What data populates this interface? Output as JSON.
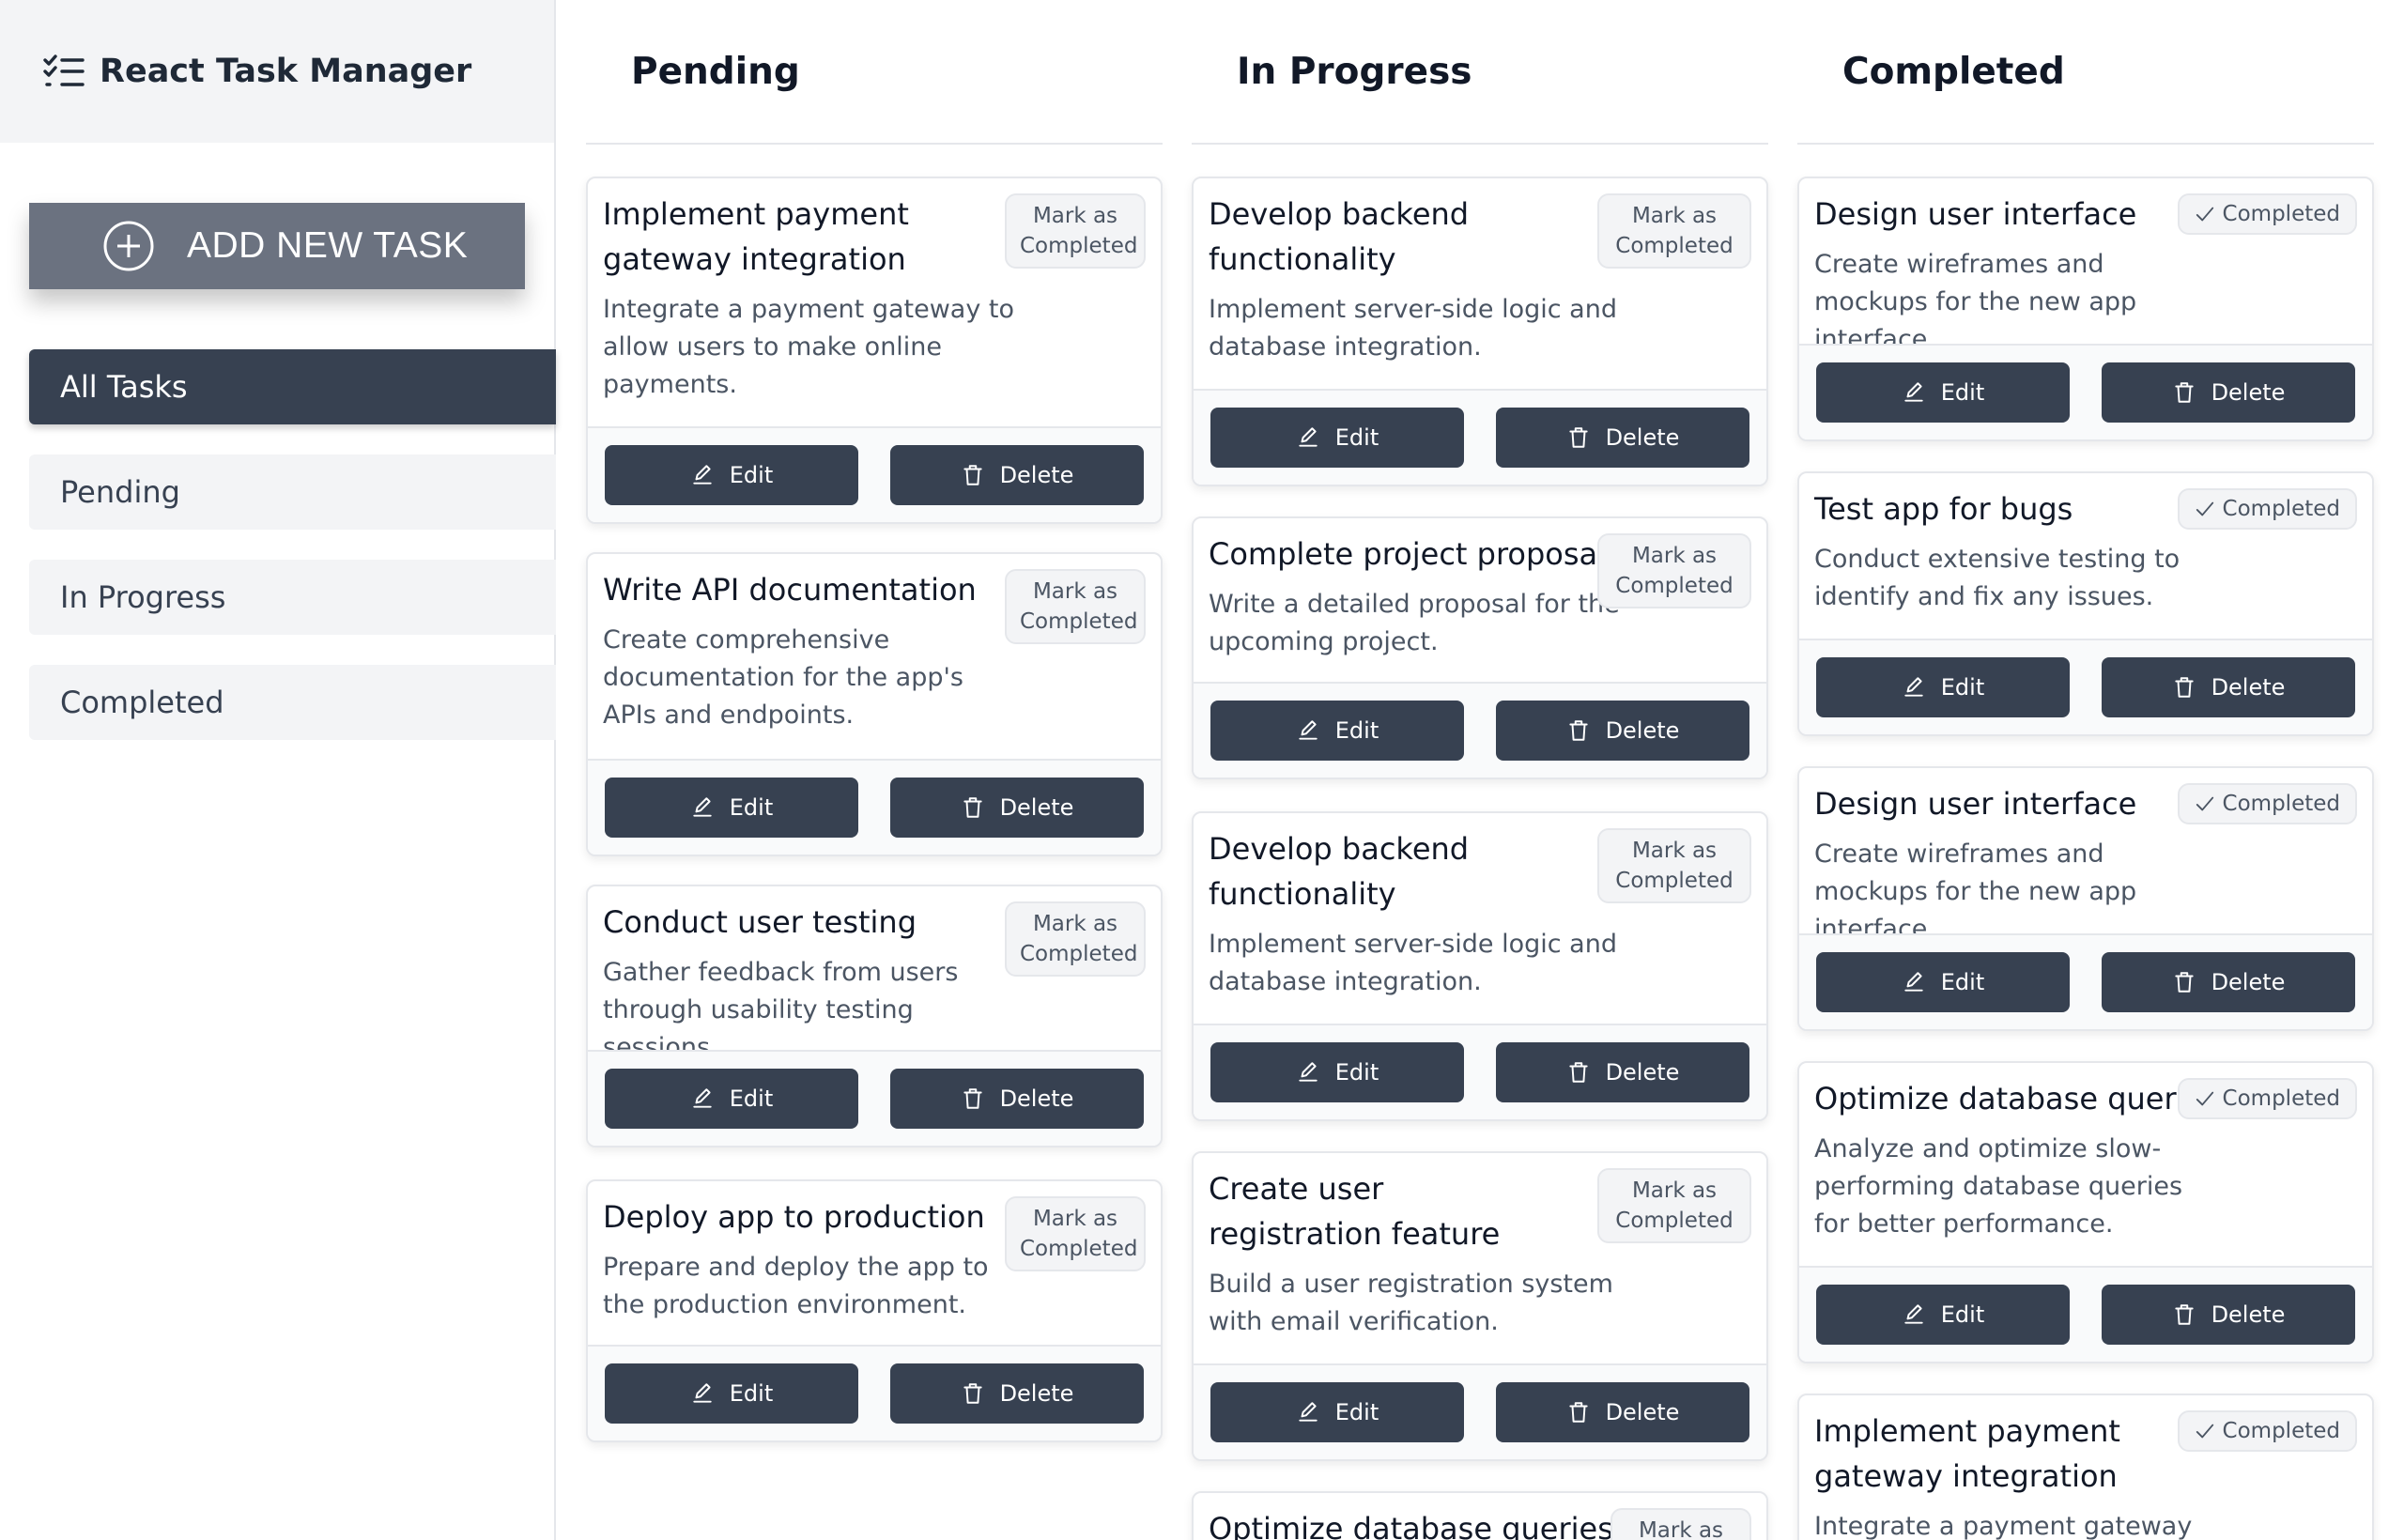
{
  "app": {
    "title": "React Task Manager"
  },
  "sidebar": {
    "add_button": "ADD NEW TASK",
    "nav": [
      {
        "label": "All Tasks",
        "active": true
      },
      {
        "label": "Pending",
        "active": false
      },
      {
        "label": "In Progress",
        "active": false
      },
      {
        "label": "Completed",
        "active": false
      }
    ]
  },
  "buttons": {
    "edit": "Edit",
    "delete": "Delete",
    "mark": "Mark as Completed",
    "completed": "Completed"
  },
  "columns": {
    "pending": {
      "title": "Pending",
      "tasks": [
        {
          "title": "Implement payment gateway integration",
          "description": "Integrate a payment gateway to allow users to make online payments."
        },
        {
          "title": "Write API documentation",
          "description": "Create comprehensive documentation for the app's APIs and endpoints."
        },
        {
          "title": "Conduct user testing",
          "description": "Gather feedback from users through usability testing sessions."
        },
        {
          "title": "Deploy app to production",
          "description": "Prepare and deploy the app to the production environment."
        }
      ]
    },
    "in_progress": {
      "title": "In Progress",
      "tasks": [
        {
          "title": "Develop backend functionality",
          "description": "Implement server-side logic and database integration."
        },
        {
          "title": "Complete project proposal",
          "description": "Write a detailed proposal for the upcoming project."
        },
        {
          "title": "Develop backend functionality",
          "description": "Implement server-side logic and database integration."
        },
        {
          "title": "Create user registration feature",
          "description": "Build a user registration system with email verification."
        },
        {
          "title": "Optimize database queries",
          "description": ""
        }
      ]
    },
    "completed": {
      "title": "Completed",
      "tasks": [
        {
          "title": "Design user interface",
          "description": "Create wireframes and mockups for the new app interface."
        },
        {
          "title": "Test app for bugs",
          "description": "Conduct extensive testing to identify and fix any issues."
        },
        {
          "title": "Design user interface",
          "description": "Create wireframes and mockups for the new app interface."
        },
        {
          "title": "Optimize database queries",
          "description": "Analyze and optimize slow-performing database queries for better performance."
        },
        {
          "title": "Implement payment gateway integration",
          "description": "Integrate a payment gateway to"
        }
      ]
    }
  }
}
